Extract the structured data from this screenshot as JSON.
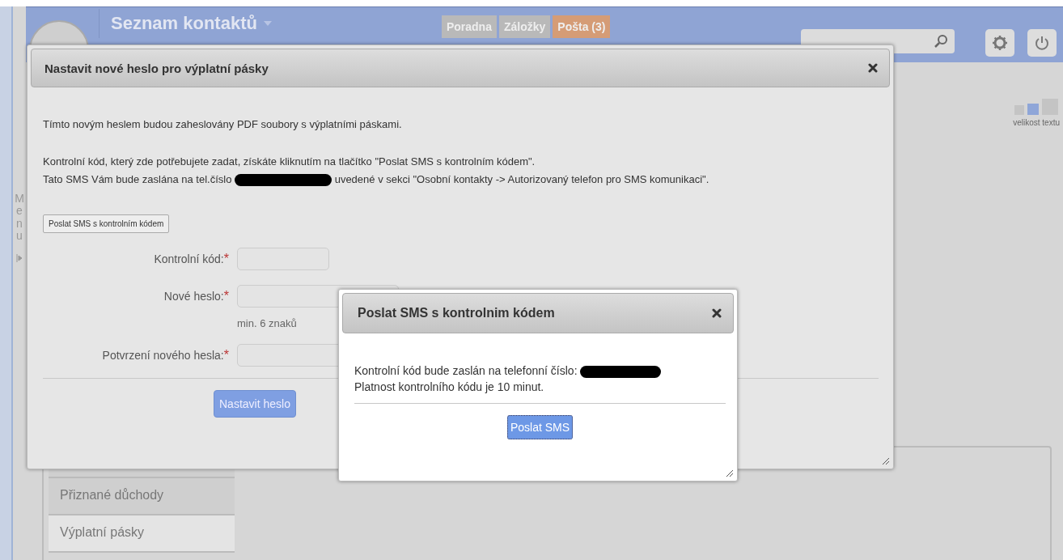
{
  "header": {
    "title": "Seznam kontaktů",
    "tabs": [
      {
        "label": "Poradna",
        "kind": "plain"
      },
      {
        "label": "Záložky",
        "kind": "plain"
      },
      {
        "label": "Pošta (3)",
        "kind": "mail"
      }
    ]
  },
  "side_menu": {
    "label": "Menu"
  },
  "text_size": {
    "label": "velikost textu",
    "options": [
      {
        "selected": false
      },
      {
        "selected": true
      },
      {
        "selected": false
      }
    ]
  },
  "side_tabs": [
    {
      "label": "Přiznané důchody",
      "selected": false
    },
    {
      "label": "Výplatní pásky",
      "selected": true
    }
  ],
  "dialog": {
    "title": "Nastavit nové heslo pro výplatní pásky",
    "intro": "Tímto novým heslem budou zaheslovány PDF soubory s výplatními páskami.",
    "info_line_1": "Kontrolní kód, který zde potřebujete zadat, získáte kliknutím na tlačítko \"Poslat SMS s kontrolním kódem\".",
    "info_line_2_before": "Tato SMS Vám bude zaslána na tel.číslo",
    "info_line_2_after": "uvedené v sekci \"Osobní kontakty -> Autorizovaný telefon pro SMS komunikaci\".",
    "sms_button": "Poslat SMS s kontrolním kódem",
    "fields": [
      {
        "label": "Kontrolní kód:",
        "required_mark": "*",
        "kind": "short"
      },
      {
        "label": "Nové heslo:",
        "required_mark": "*",
        "kind": "long",
        "hint": "min. 6 znaků"
      },
      {
        "label": "Potvrzení nového hesla:",
        "required_mark": "*",
        "kind": "long"
      }
    ],
    "submit": "Nastavit heslo"
  },
  "popup": {
    "title": "Poslat SMS s kontrolnim kódem",
    "line_1": "Kontrolní kód bude zaslán na telefonní číslo:",
    "line_2": "Platnost kontrolního kódu je 10 minut.",
    "button": "Poslat SMS"
  }
}
